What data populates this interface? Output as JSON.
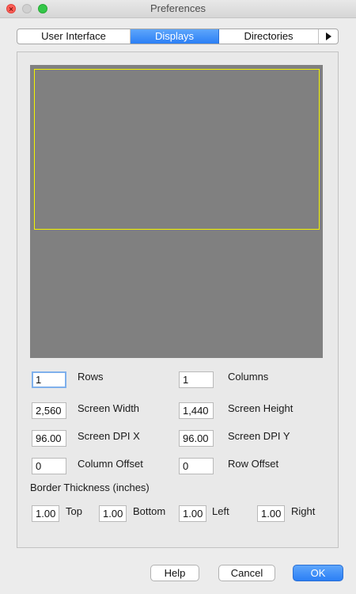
{
  "window": {
    "title": "Preferences"
  },
  "tabs": [
    {
      "label": "User Interface",
      "selected": false
    },
    {
      "label": "Displays",
      "selected": true
    },
    {
      "label": "Directories",
      "selected": false
    }
  ],
  "tab_overflow_icon": "triangle-right-icon",
  "colors": {
    "accent": "#2b7ff5",
    "preview_background": "#808080",
    "screen_outline": "#f5f500"
  },
  "fields": {
    "rows": {
      "label": "Rows",
      "value": "1"
    },
    "columns": {
      "label": "Columns",
      "value": "1"
    },
    "screen_width": {
      "label": "Screen Width",
      "value": "2,560"
    },
    "screen_height": {
      "label": "Screen Height",
      "value": "1,440"
    },
    "dpi_x": {
      "label": "Screen DPI X",
      "value": "96.00"
    },
    "dpi_y": {
      "label": "Screen DPI Y",
      "value": "96.00"
    },
    "column_offset": {
      "label": "Column Offset",
      "value": "0"
    },
    "row_offset": {
      "label": "Row Offset",
      "value": "0"
    }
  },
  "border": {
    "heading": "Border Thickness (inches)",
    "top": {
      "label": "Top",
      "value": "1.00"
    },
    "bottom": {
      "label": "Bottom",
      "value": "1.00"
    },
    "left": {
      "label": "Left",
      "value": "1.00"
    },
    "right": {
      "label": "Right",
      "value": "1.00"
    }
  },
  "buttons": {
    "help": "Help",
    "cancel": "Cancel",
    "ok": "OK"
  }
}
